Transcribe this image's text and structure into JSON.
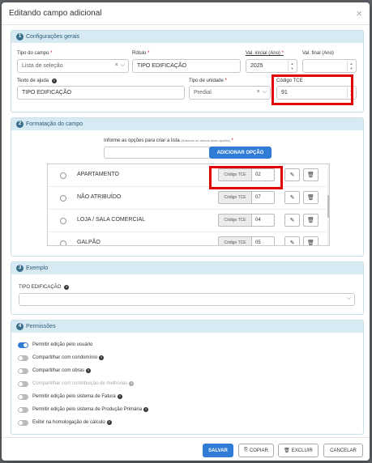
{
  "modal": {
    "title": "Editando campo adicional",
    "close": "×"
  },
  "section1": {
    "num": "1",
    "title": "Configurações gerais",
    "tipo_campo": {
      "label": "Tipo do campo",
      "value": "Lista de seleção"
    },
    "rotulo": {
      "label": "Rótulo",
      "value": "TIPO EDIFICAÇÃO"
    },
    "val_inicial": {
      "label": "Val. inicial (Ano)",
      "value": "2025"
    },
    "val_final": {
      "label": "Val. final (Ano)",
      "value": ""
    },
    "texto_ajuda": {
      "label": "Texto de ajuda",
      "value": "TIPO EDIFICAÇÃO"
    },
    "tipo_unidade": {
      "label": "Tipo de unidade",
      "value": "Predial"
    },
    "codigo_tce": {
      "label": "Código TCE",
      "value": "91"
    }
  },
  "section2": {
    "num": "2",
    "title": "Formatação do campo",
    "instruction": "Informe as opções para criar a lista",
    "instruction_hint": "(Adicione ao menos duas opções)",
    "add_button": "ADICIONAR OPÇÃO",
    "tce_label": "Código TCE",
    "options": [
      {
        "label": "APARTAMENTO",
        "code": "02"
      },
      {
        "label": "NÃO ATRIBUÍDO",
        "code": "07"
      },
      {
        "label": "LOJA / SALA COMERCIAL",
        "code": "04"
      },
      {
        "label": "GALPÃO",
        "code": "05"
      }
    ]
  },
  "section3": {
    "num": "3",
    "title": "Exemplo",
    "field_label": "TIPO EDIFICAÇÃO"
  },
  "section4": {
    "num": "4",
    "title": "Permissões",
    "toggles": [
      {
        "label": "Permitir edição pelo usuário",
        "on": true,
        "help": false,
        "disabled": false
      },
      {
        "label": "Compartilhar com condomínio",
        "on": false,
        "help": true,
        "disabled": false
      },
      {
        "label": "Compartilhar com obras",
        "on": false,
        "help": true,
        "disabled": false
      },
      {
        "label": "Compartilhar com contribuição de melhorias",
        "on": false,
        "help": true,
        "disabled": true
      },
      {
        "label": "Permitir edição pelo sistema de Fatura",
        "on": false,
        "help": true,
        "disabled": false
      },
      {
        "label": "Permitir edição pelo sistema de Produção Primária",
        "on": false,
        "help": true,
        "disabled": false
      },
      {
        "label": "Exibir na homologação de cálculo",
        "on": false,
        "help": true,
        "disabled": false
      }
    ]
  },
  "footer": {
    "save": "SALVAR",
    "copy": "COPIAR",
    "delete": "EXCLUIR",
    "cancel": "CANCELAR"
  },
  "colors": {
    "primary": "#2f7bd6",
    "panel_head": "#d7e9f2",
    "highlight": "#e00000"
  }
}
